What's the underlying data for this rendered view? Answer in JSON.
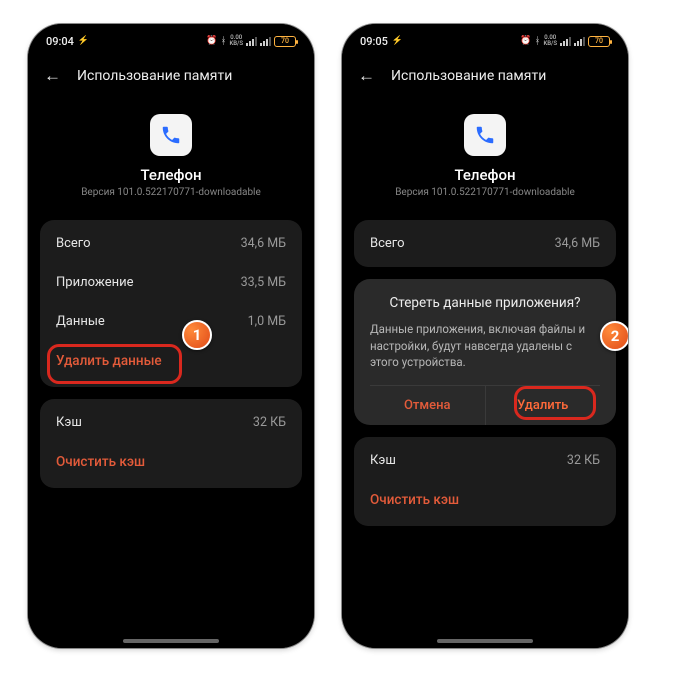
{
  "step_badges": {
    "one": "1",
    "two": "2"
  },
  "screen1": {
    "status": {
      "time": "09:04",
      "speed_top": "0.00",
      "speed_unit": "KB/S",
      "battery": "70"
    },
    "header": {
      "title": "Использование памяти"
    },
    "app": {
      "name": "Телефон",
      "version": "Версия 101.0.522170771-downloadable"
    },
    "card1": {
      "total_label": "Всего",
      "total_value": "34,6 МБ",
      "app_label": "Приложение",
      "app_value": "33,5 МБ",
      "data_label": "Данные",
      "data_value": "1,0 МБ",
      "clear_data_action": "Удалить данные"
    },
    "card2": {
      "cache_label": "Кэш",
      "cache_value": "32 КБ",
      "clear_cache_action": "Очистить кэш"
    }
  },
  "screen2": {
    "status": {
      "time": "09:05",
      "speed_top": "0.00",
      "speed_unit": "KB/S",
      "battery": "70"
    },
    "header": {
      "title": "Использование памяти"
    },
    "app": {
      "name": "Телефон",
      "version": "Версия 101.0.522170771-downloadable"
    },
    "card1": {
      "total_label": "Всего",
      "total_value": "34,6 МБ"
    },
    "dialog": {
      "title": "Стереть данные приложения?",
      "text": "Данные приложения, включая файлы и настройки, будут навсегда удалены с этого устройства.",
      "cancel": "Отмена",
      "confirm": "Удалить"
    },
    "card2": {
      "cache_label": "Кэш",
      "cache_value": "32 КБ",
      "clear_cache_action": "Очистить кэш"
    }
  }
}
